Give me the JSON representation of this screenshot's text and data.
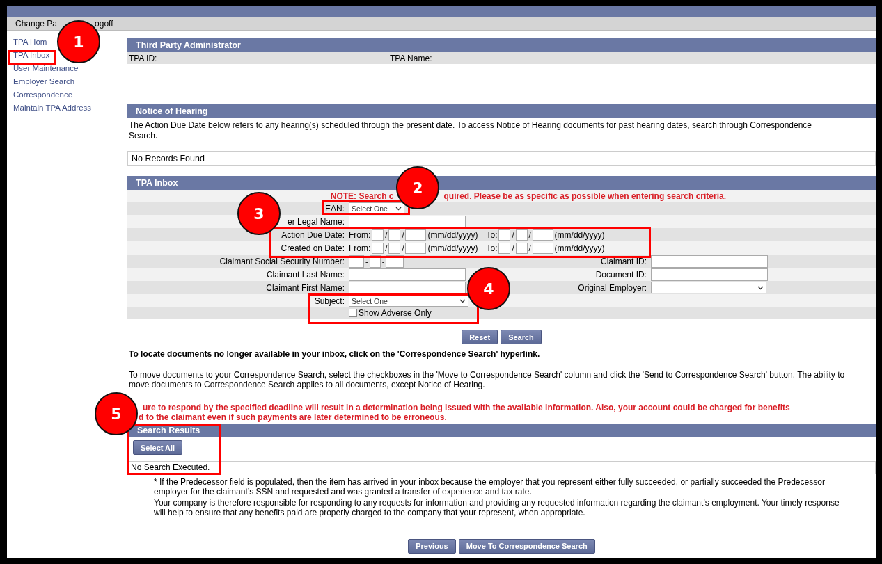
{
  "top_bar": {
    "links": [
      "Change Pa",
      "ogoff"
    ]
  },
  "sidebar": {
    "items": [
      "TPA Hom",
      "TPA Inbox",
      "User Maintenance",
      "Employer Search",
      "Correspondence",
      "Maintain TPA Address"
    ]
  },
  "tpa_section": {
    "title": "Third Party Administrator",
    "fields": [
      "TPA ID:",
      "TPA Name:"
    ]
  },
  "notice_section": {
    "title": "Notice of Hearing",
    "text": "The Action Due Date below refers to any hearing(s) scheduled through the present date. To access Notice of Hearing documents for past hearing dates, search through Correspondence Search.",
    "records": "No Records Found"
  },
  "inbox_section": {
    "title": "TPA Inbox",
    "note_parts": [
      "NOTE:  Search c",
      "quired. Please be as specific as possible when entering search criteria."
    ],
    "rows": [
      {
        "kind": "select",
        "label": "EAN:",
        "value": "Select One"
      },
      {
        "kind": "text",
        "label": "er Legal Name:"
      },
      {
        "kind": "date_range",
        "label": "Action Due Date:",
        "from": {
          "label": "From:",
          "separators": [
            "/",
            "/"
          ],
          "format": "(mm/dd/yyyy)"
        },
        "to": {
          "label": "To:",
          "separators": [
            "/",
            "/"
          ],
          "format": "(mm/dd/yyyy)"
        }
      },
      {
        "kind": "date_range",
        "label": "Created on Date:",
        "from": {
          "label": "From:",
          "separators": [
            "/",
            "/"
          ],
          "format": "(mm/dd/yyyy)"
        },
        "to": {
          "label": "To:",
          "separators": [
            "/",
            "/"
          ],
          "format": "(mm/dd/yyyy)"
        }
      },
      {
        "kind": "ssn",
        "label": "Claimant Social Security Number:",
        "separators": [
          "-",
          "-"
        ],
        "right": {
          "kind": "text",
          "label": "Claimant ID:"
        }
      },
      {
        "kind": "text",
        "label": "Claimant Last Name:",
        "right": {
          "kind": "text",
          "label": "Document ID:"
        }
      },
      {
        "kind": "text",
        "label": "Claimant First Name:",
        "right": {
          "kind": "select",
          "label": "Original Employer:"
        }
      },
      {
        "kind": "select",
        "label": "Subject:",
        "value": "Select One"
      },
      {
        "kind": "checkbox",
        "label": "Show Adverse Only",
        "checked": false
      }
    ],
    "buttons": [
      "Reset",
      "Search"
    ]
  },
  "info": {
    "locate": "To locate documents no longer available in your inbox, click on the 'Correspondence Search' hyperlink.",
    "move": "To move documents to your Correspondence Search, select the checkboxes in the 'Move to Correspondence Search' column and click the 'Send to Correspondence Search' button. The ability to move documents to Correspondence Search applies to all documents, except Notice of Hearing.",
    "warning_parts": [
      "ure to respond by the specified deadline will result in a determination being issued with the available information. Also, your account could be charged for benefits",
      "d to the claimant even if such payments are later determined to be erroneous."
    ]
  },
  "results_section": {
    "title": "Search Results",
    "select_all": "Select All",
    "status": "No Search Executed."
  },
  "footnotes": [
    "* If the Predecessor field is populated, then the item has arrived in your inbox because the employer that you represent either fully succeeded, or partially succeeded the Predecessor employer for the claimant’s SSN and requested and was granted a transfer of experience and tax rate.",
    "Your company is therefore responsible for responding to any requests for information and providing any requested information regarding the claimant’s employment. Your timely response will help to ensure that any benefits paid are properly charged to the company that your represent, when appropriate."
  ],
  "bottom_buttons": [
    "Previous",
    "Move To Correspondence Search"
  ],
  "callouts": [
    {
      "number": "1"
    },
    {
      "number": "2"
    },
    {
      "number": "3"
    },
    {
      "number": "4"
    },
    {
      "number": "5"
    }
  ]
}
